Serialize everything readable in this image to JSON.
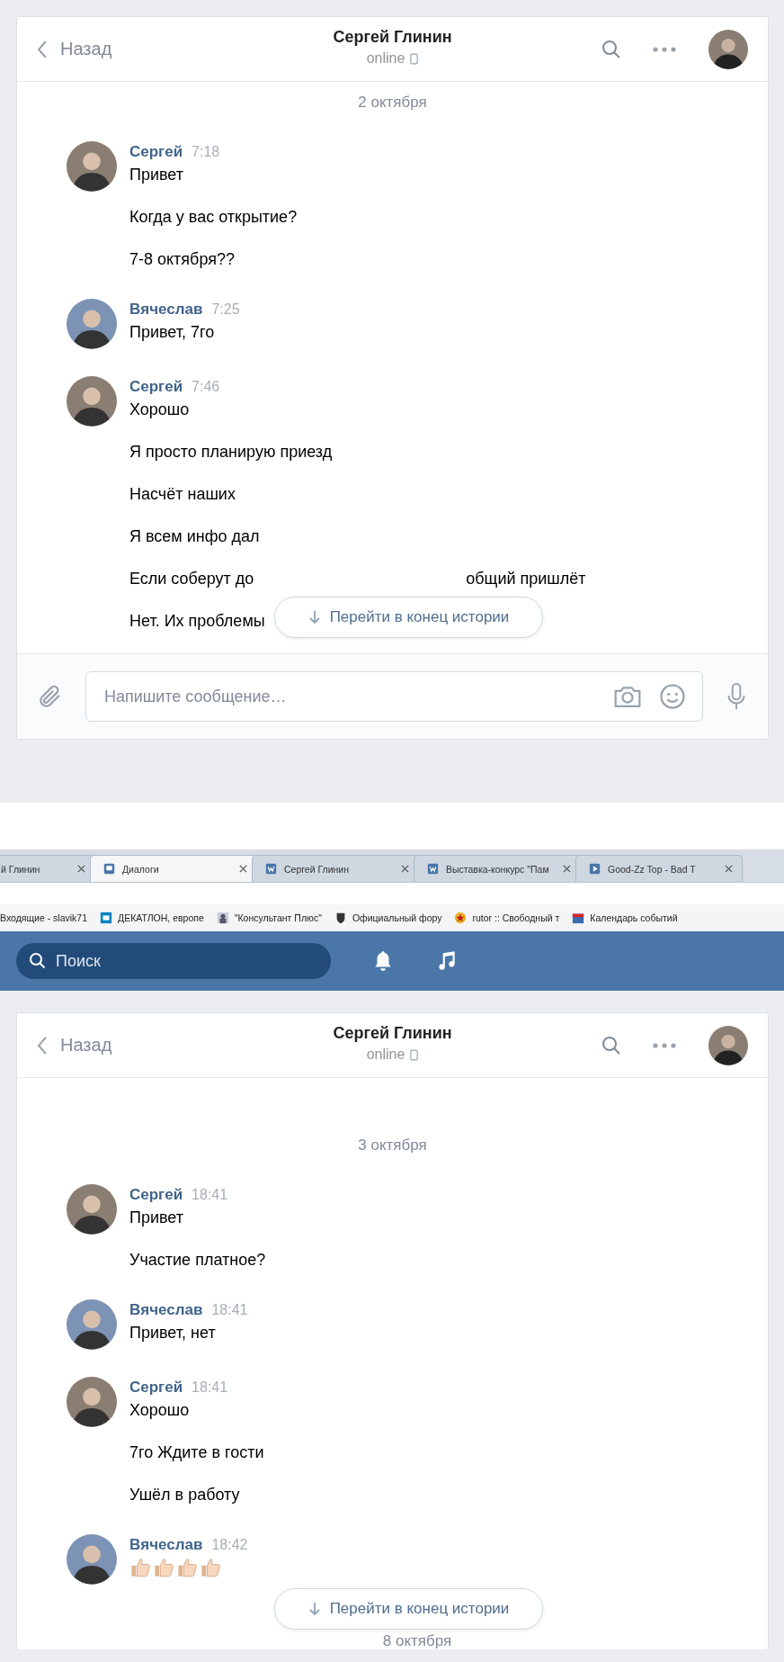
{
  "chats": [
    {
      "header": {
        "back": "Назад",
        "title": "Сергей Глинин",
        "status": "online"
      },
      "feed": [
        {
          "kind": "date",
          "text": "2 октября"
        },
        {
          "kind": "message",
          "author": "Сергей",
          "time": "7:18",
          "lines": [
            {
              "kind": "text",
              "text": "Привет"
            },
            {
              "kind": "text",
              "text": "Когда у вас открытие?"
            },
            {
              "kind": "text",
              "text": "7-8 октября??"
            }
          ]
        },
        {
          "kind": "message",
          "author": "Вячеслав",
          "time": "7:25",
          "lines": [
            {
              "kind": "text",
              "text": "Привет, 7го"
            }
          ]
        },
        {
          "kind": "message",
          "author": "Сергей",
          "time": "7:46",
          "lines": [
            {
              "kind": "text",
              "text": "Хорошо"
            },
            {
              "kind": "text",
              "text": "Я просто планирую приезд"
            },
            {
              "kind": "text",
              "text": "Насчёт наших"
            },
            {
              "kind": "text",
              "text": "Я всем инфо дал"
            },
            {
              "kind": "covered",
              "parts": [
                "Если соберут до",
                "общий пришлёт"
              ]
            },
            {
              "kind": "text",
              "text": "Нет. Их проблемы"
            }
          ]
        }
      ],
      "jump_button": "Перейти в конец истории",
      "composer": {
        "placeholder": "Напишите сообщение…"
      }
    },
    {
      "header": {
        "back": "Назад",
        "title": "Сергей Глинин",
        "status": "online"
      },
      "feed": [
        {
          "kind": "date",
          "text": "3 октября"
        },
        {
          "kind": "message",
          "author": "Сергей",
          "time": "18:41",
          "lines": [
            {
              "kind": "text",
              "text": "Привет"
            },
            {
              "kind": "text",
              "text": "Участие платное?"
            }
          ]
        },
        {
          "kind": "message",
          "author": "Вячеслав",
          "time": "18:41",
          "lines": [
            {
              "kind": "text",
              "text": "Привет, нет"
            }
          ]
        },
        {
          "kind": "message",
          "author": "Сергей",
          "time": "18:41",
          "lines": [
            {
              "kind": "text",
              "text": "Хорошо"
            },
            {
              "kind": "text",
              "text": "7го Ждите в гости"
            },
            {
              "kind": "text",
              "text": "Ушёл в работу"
            }
          ]
        },
        {
          "kind": "message",
          "author": "Вячеслав",
          "time": "18:42",
          "lines": [
            {
              "kind": "stickers",
              "items": [
                {
                  "kind": "thumbs-up"
                },
                {
                  "kind": "thumbs-up"
                },
                {
                  "kind": "thumbs-up"
                },
                {
                  "kind": "thumbs-up"
                }
              ]
            }
          ]
        },
        {
          "kind": "date",
          "text": "8 октября"
        }
      ],
      "jump_button": "Перейти в конец истории"
    }
  ],
  "browser": {
    "tabs": [
      {
        "title": "й Глинин",
        "selected": false
      },
      {
        "title": "Диалоги",
        "selected": true
      },
      {
        "title": "Сергей Глинин",
        "selected": false
      },
      {
        "title": "Выставка-конкурс \"Пам",
        "selected": false
      },
      {
        "title": "Good-Zz Top - Bad T",
        "selected": false
      }
    ],
    "bookmarks": [
      "Входящие - slavik71",
      "ДЕКАТЛОН, европе",
      "\"Консультант Плюс\"",
      "Официальный фору",
      "rutor :: Свободный т",
      "Календарь событий"
    ],
    "search": {
      "placeholder": "Поиск"
    }
  }
}
